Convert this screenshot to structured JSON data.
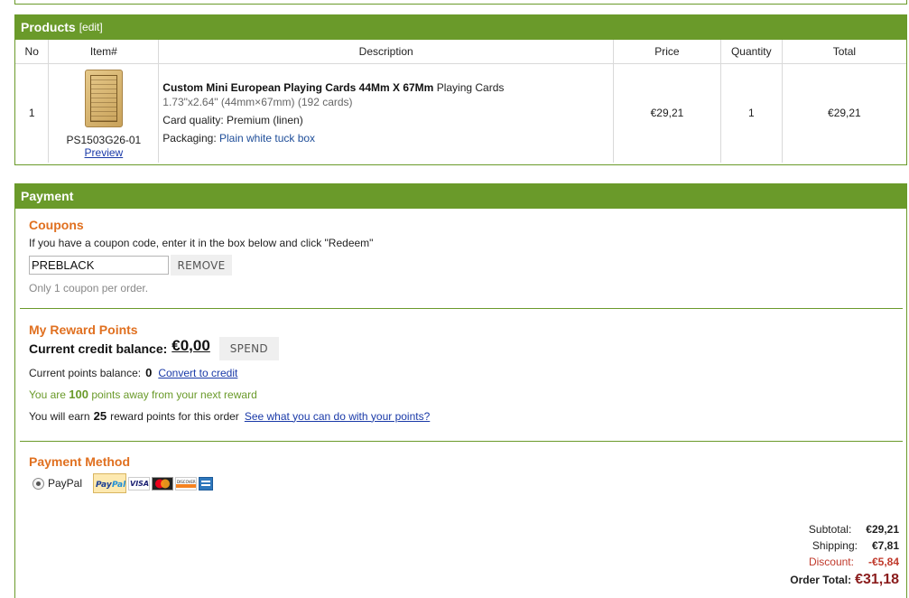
{
  "products": {
    "title": "Products",
    "edit_label": "[edit]",
    "columns": [
      "No",
      "Item#",
      "Description",
      "Price",
      "Quantity",
      "Total"
    ],
    "row": {
      "no": "1",
      "sku": "PS1503G26-01",
      "preview_label": "Preview",
      "title_bold": "Custom Mini European Playing Cards 44Mm X 67Mm",
      "title_rest": "Playing Cards",
      "dimensions": "1.73\"x2.64\" (44mm×67mm) (192 cards)",
      "quality_label": "Card quality:",
      "quality_value": "Premium (linen)",
      "packaging_label": "Packaging:",
      "packaging_value": "Plain white tuck box",
      "price": "€29,21",
      "quantity": "1",
      "total": "€29,21"
    }
  },
  "payment": {
    "title": "Payment",
    "coupons": {
      "title": "Coupons",
      "instructions": "If you have a coupon code, enter it in the box below and click \"Redeem\"",
      "code_value": "PREBLACK",
      "remove_label": "REMOVE",
      "note": "Only 1 coupon per order."
    },
    "rewards": {
      "title": "My Reward Points",
      "credit_label": "Current credit balance:",
      "credit_value": "€0,00",
      "spend_label": "SPEND",
      "points_label": "Current points balance:",
      "points_value": "0",
      "convert_label": "Convert to credit",
      "away_prefix": "You are",
      "away_value": "100",
      "away_suffix": "points away from your next reward",
      "earn_prefix": "You will earn",
      "earn_value": "25",
      "earn_suffix": "reward points for this order",
      "see_label": "See what you can do with your points?"
    },
    "method": {
      "title": "Payment Method",
      "option_label": "PayPal",
      "selected": true,
      "icons": [
        "paypal-logo",
        "visa-logo",
        "mastercard-logo",
        "discover-logo",
        "amex-logo"
      ]
    },
    "totals": {
      "subtotal_label": "Subtotal:",
      "subtotal_value": "€29,21",
      "shipping_label": "Shipping:",
      "shipping_value": "€7,81",
      "discount_label": "Discount:",
      "discount_value": "-€5,84",
      "order_total_label": "Order Total:",
      "order_total_value": "€31,18"
    }
  },
  "colors": {
    "header_green": "#6a9a2a",
    "section_orange": "#e07020",
    "link_blue": "#1a3aa8",
    "discount_red": "#c0392b",
    "total_darkred": "#8a1c1c"
  }
}
